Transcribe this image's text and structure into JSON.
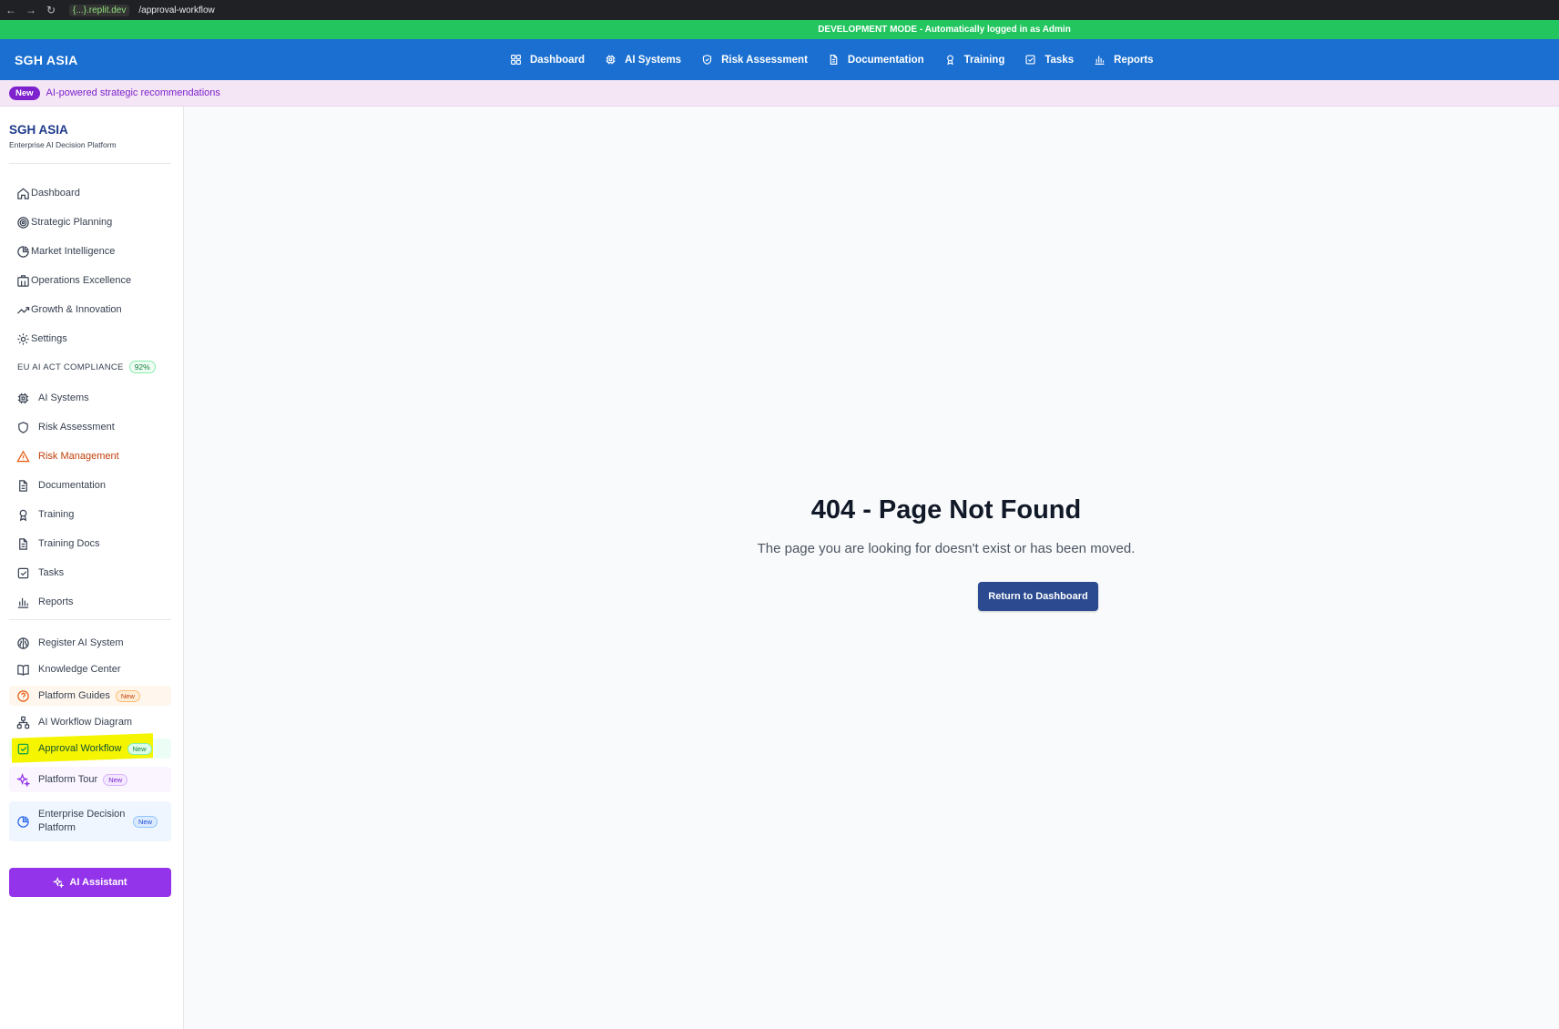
{
  "browser": {
    "host": "{...}.replit.dev",
    "path": "/approval-workflow"
  },
  "devbar": {
    "text": "DEVELOPMENT MODE - Automatically logged in as Admin"
  },
  "topnav": {
    "brand": "SGH ASIA",
    "links": [
      {
        "label": "Dashboard",
        "icon": "grid-icon"
      },
      {
        "label": "AI Systems",
        "icon": "cpu-icon"
      },
      {
        "label": "Risk Assessment",
        "icon": "shield-icon"
      },
      {
        "label": "Documentation",
        "icon": "file-icon"
      },
      {
        "label": "Training",
        "icon": "award-icon"
      },
      {
        "label": "Tasks",
        "icon": "checkbox-icon"
      },
      {
        "label": "Reports",
        "icon": "bar-chart-icon"
      }
    ]
  },
  "announcement": {
    "badge": "New",
    "text": "AI-powered strategic recommendations"
  },
  "sidebar": {
    "title": "SGH ASIA",
    "subtitle": "Enterprise AI Decision Platform",
    "primary_items": [
      {
        "label": "Dashboard",
        "icon": "home-icon"
      },
      {
        "label": "Strategic Planning",
        "icon": "target-icon"
      },
      {
        "label": "Market Intelligence",
        "icon": "pie-chart-icon"
      },
      {
        "label": "Operations Excellence",
        "icon": "building-icon"
      },
      {
        "label": "Growth & Innovation",
        "icon": "trending-up-icon"
      },
      {
        "label": "Settings",
        "icon": "gear-icon"
      }
    ],
    "compliance": {
      "label": "EU AI ACT COMPLIANCE",
      "percent": "92%",
      "items": [
        {
          "label": "AI Systems",
          "icon": "cpu-icon"
        },
        {
          "label": "Risk Assessment",
          "icon": "shield-icon"
        },
        {
          "label": "Risk Management",
          "icon": "warning-icon",
          "color": "#c2410c"
        },
        {
          "label": "Documentation",
          "icon": "file-icon"
        },
        {
          "label": "Training",
          "icon": "award-icon"
        },
        {
          "label": "Training Docs",
          "icon": "file-icon"
        },
        {
          "label": "Tasks",
          "icon": "checkbox-icon"
        },
        {
          "label": "Reports",
          "icon": "bar-chart-icon"
        }
      ]
    },
    "extra_items": [
      {
        "label": "Register AI System",
        "icon": "brain-icon"
      },
      {
        "label": "Knowledge Center",
        "icon": "book-icon"
      },
      {
        "label": "Platform Guides",
        "icon": "help-circle-icon",
        "badge": "New"
      },
      {
        "label": "AI Workflow Diagram",
        "icon": "workflow-icon"
      },
      {
        "label": "Approval Workflow",
        "icon": "checkbox-icon",
        "badge": "New"
      },
      {
        "label": "Platform Tour",
        "icon": "sparkles-icon",
        "badge": "New"
      },
      {
        "label": "Enterprise Decision Platform",
        "label_line1": "Enterprise Decision",
        "label_line2": "Platform",
        "icon": "pie-chart-icon",
        "badge": "New"
      }
    ],
    "ai_button": "AI Assistant"
  },
  "main": {
    "title": "404 - Page Not Found",
    "message": "The page you are looking for doesn't exist or has been moved.",
    "button": "Return to Dashboard"
  },
  "colors": {
    "devbar": "#22c55e",
    "topnav": "#1a6fd1",
    "accent_purple": "#9333ea",
    "highlight_yellow": "#f5f500",
    "primary_button": "#2b4a8f"
  }
}
